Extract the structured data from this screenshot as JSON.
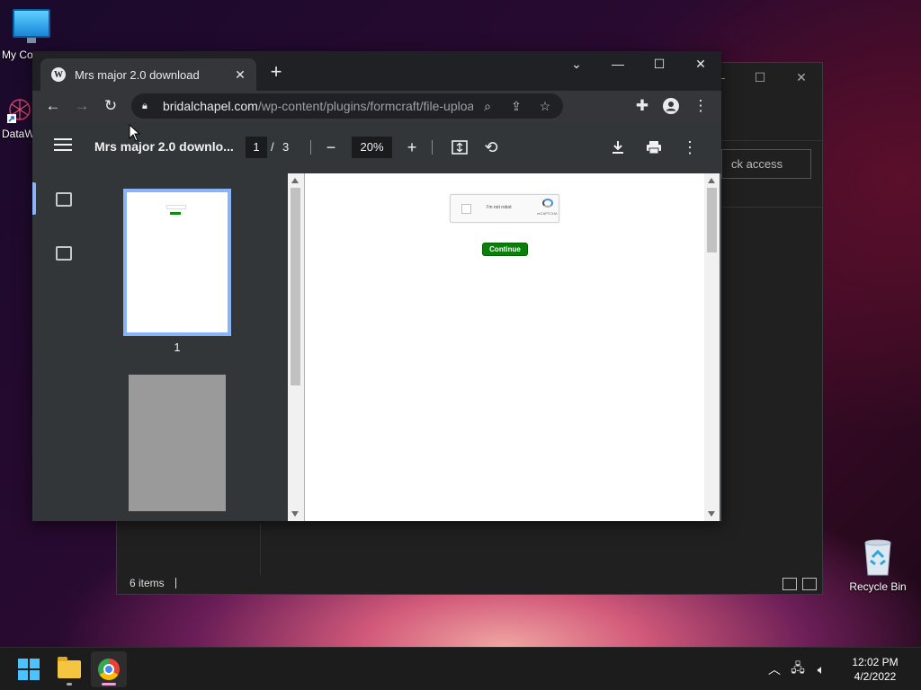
{
  "desktop": {
    "icons": [
      {
        "label": "My Co"
      },
      {
        "label": "DataW"
      },
      {
        "label": "Recycle Bin"
      }
    ]
  },
  "explorer": {
    "quick_access": "ck access",
    "status_items": "6 items"
  },
  "browser": {
    "tab_title": "Mrs major 2.0 download",
    "tab_close": "✕",
    "new_tab": "+",
    "url_host": "bridalchapel.com",
    "url_path": "/wp-content/plugins/formcraft/file-upload/serv..."
  },
  "pdf": {
    "title": "Mrs major 2.0 downlo...",
    "current_page": "1",
    "separator": "/",
    "total_pages": "3",
    "zoom": "20%",
    "thumb_page_number": "1",
    "captcha_text": "I'm not robot",
    "captcha_brand": "reCAPTCHA",
    "continue_label": "Continue"
  },
  "taskbar": {
    "time": "12:02 PM",
    "date": "4/2/2022"
  },
  "colors": {
    "accent_blue": "#8ab4f8",
    "continue_green": "#0a7f0a",
    "windows_blue": "#4cc2ff"
  }
}
